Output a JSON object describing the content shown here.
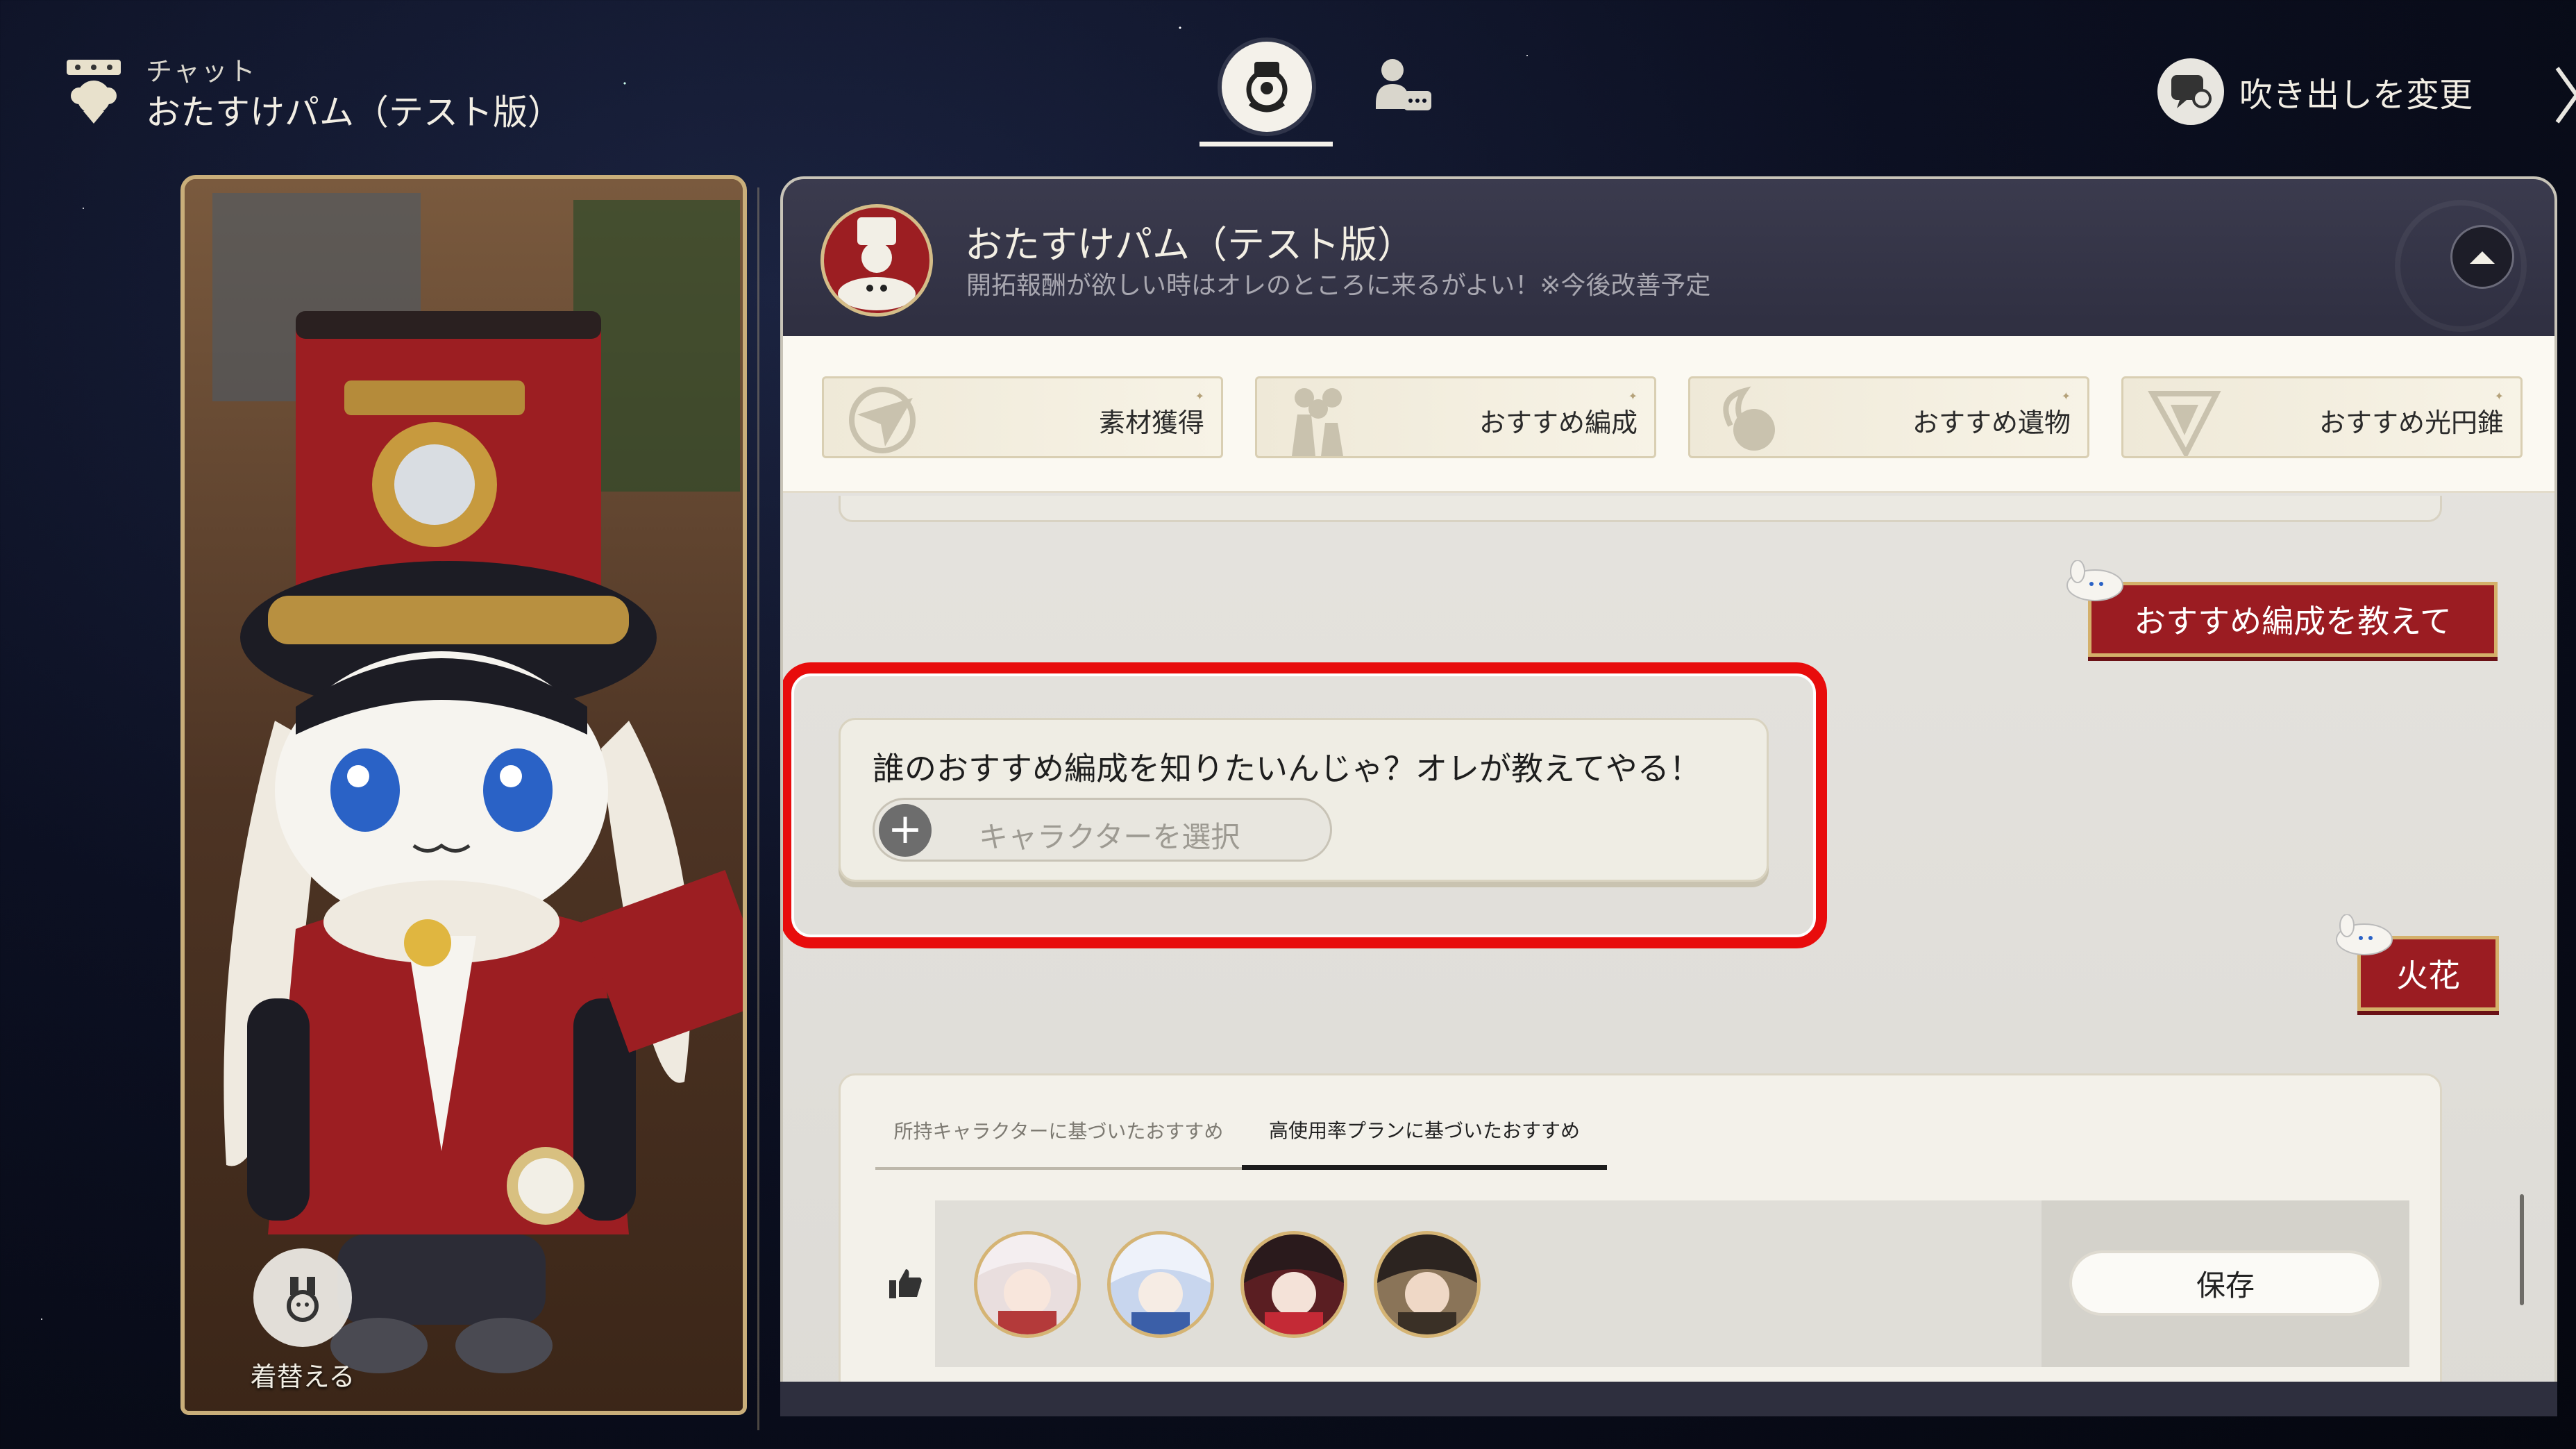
{
  "header": {
    "subtitle": "チャット",
    "title": "おたすけパム（テスト版）",
    "bubble_label": "吹き出しを変更"
  },
  "character_panel": {
    "change_outfit_label": "着替える"
  },
  "chat": {
    "name": "おたすけパム（テスト版）",
    "description": "開拓報酬が欲しい時はオレのところに来るがよい！※今後改善予定",
    "quick_actions": [
      {
        "label": "素材獲得",
        "icon": "paper-plane-icon"
      },
      {
        "label": "おすすめ編成",
        "icon": "team-icon"
      },
      {
        "label": "おすすめ遺物",
        "icon": "relic-icon"
      },
      {
        "label": "おすすめ光円錐",
        "icon": "light-cone-icon"
      }
    ],
    "messages": {
      "user_1": "おすすめ編成を教えて",
      "bot_1": "誰のおすすめ編成を知りたいんじゃ？オレが教えてやる！",
      "select_placeholder": "キャラクターを選択",
      "user_2": "火花"
    },
    "recommend": {
      "tabs": [
        "所持キャラクターに基づいたおすすめ",
        "高使用率プランに基づいたおすすめ"
      ],
      "active_tab": 1,
      "save_label": "保存",
      "characters": [
        "character-1",
        "character-2",
        "character-3",
        "character-4"
      ]
    }
  },
  "colors": {
    "accent_red": "#9b1c22",
    "highlight_red": "#e80c0c",
    "gold": "#d4b06a"
  }
}
